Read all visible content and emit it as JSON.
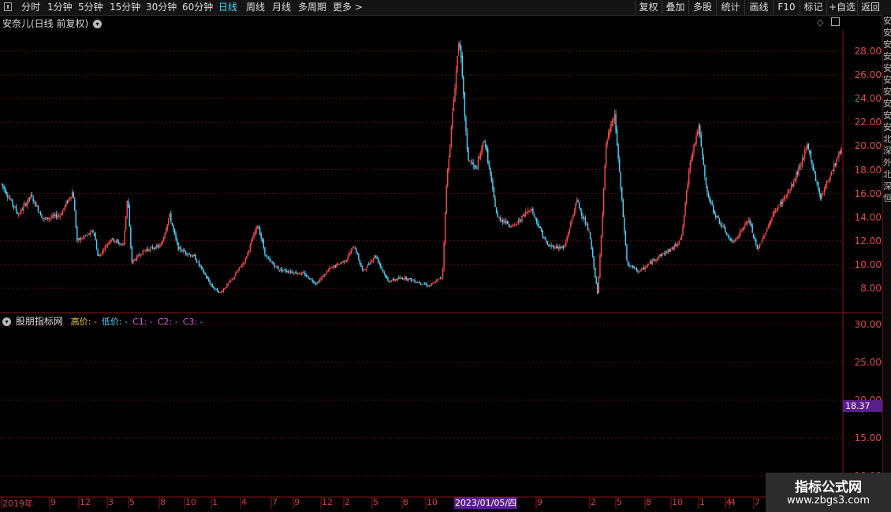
{
  "toolbar": {
    "periods": [
      "分时",
      "1分钟",
      "5分钟",
      "15分钟",
      "30分钟",
      "60分钟",
      "日线",
      "周线",
      "月线",
      "多周期",
      "更多 >"
    ],
    "active_period": "日线",
    "right_buttons": [
      "复权",
      "叠加",
      "多股",
      "统计",
      "画线",
      "F10",
      "标记",
      "+自选",
      "返回"
    ]
  },
  "main_panel": {
    "title": "安奈儿(日线 前复权)",
    "y_ticks": [
      "28.00",
      "26.00",
      "24.00",
      "22.00",
      "20.00",
      "18.00",
      "16.00",
      "14.00",
      "12.00",
      "10.00",
      "8.00"
    ]
  },
  "indicator_panel": {
    "name": "股朋指标网",
    "legend": [
      {
        "text": "高价: -",
        "color": "#e6c84a"
      },
      {
        "text": "低价: -",
        "color": "#4fd7ff"
      },
      {
        "text": "C1: -",
        "color": "#d855d8"
      },
      {
        "text": "C2: -",
        "color": "#d855d8"
      },
      {
        "text": "C3: -",
        "color": "#d855d8"
      }
    ],
    "y_ticks": [
      "30.00",
      "25.00",
      "20.00",
      "15.00",
      "10.00"
    ],
    "current_price": "18.37"
  },
  "x_axis": {
    "labels": [
      "2019年",
      "9",
      "12",
      "3",
      "5",
      "8",
      "10",
      "1",
      "4",
      "7",
      "9",
      "12",
      "2",
      "5",
      "8",
      "10",
      "4",
      "9",
      "2",
      "5",
      "8",
      "10",
      "1",
      "4",
      "7"
    ],
    "crosshair_date": "2023/01/05/四"
  },
  "right_strip_chars": [
    "安",
    "安",
    "安",
    "安",
    "安",
    "安",
    "安",
    "安",
    "安",
    "安",
    "北",
    "深",
    "外",
    "北",
    "深",
    "恒"
  ],
  "watermark": {
    "line1": "指标公式网",
    "line2": "www.zbgs3.com"
  },
  "colors": {
    "up": "#ff4d4d",
    "down": "#4fd7ff",
    "grid": "#5a0d0d",
    "axis": "#8a1818",
    "tag": "#5a1f8a"
  },
  "chart_data": {
    "type": "candlestick",
    "title": "安奈儿(日线 前复权)",
    "ylim": [
      7.0,
      29.8
    ],
    "price_path": [
      [
        0,
        16.8
      ],
      [
        0.02,
        14.2
      ],
      [
        0.035,
        15.8
      ],
      [
        0.05,
        13.8
      ],
      [
        0.07,
        14.2
      ],
      [
        0.085,
        16.2
      ],
      [
        0.09,
        12.0
      ],
      [
        0.11,
        12.8
      ],
      [
        0.115,
        10.6
      ],
      [
        0.13,
        12.2
      ],
      [
        0.145,
        11.6
      ],
      [
        0.15,
        15.8
      ],
      [
        0.155,
        10.2
      ],
      [
        0.17,
        11.2
      ],
      [
        0.19,
        11.6
      ],
      [
        0.2,
        14.2
      ],
      [
        0.21,
        11.4
      ],
      [
        0.23,
        10.6
      ],
      [
        0.25,
        8.2
      ],
      [
        0.26,
        7.6
      ],
      [
        0.275,
        8.8
      ],
      [
        0.29,
        10.4
      ],
      [
        0.305,
        13.4
      ],
      [
        0.315,
        10.6
      ],
      [
        0.33,
        9.6
      ],
      [
        0.36,
        9.2
      ],
      [
        0.375,
        8.4
      ],
      [
        0.39,
        9.6
      ],
      [
        0.41,
        10.4
      ],
      [
        0.42,
        11.6
      ],
      [
        0.43,
        9.4
      ],
      [
        0.445,
        10.8
      ],
      [
        0.46,
        8.6
      ],
      [
        0.48,
        8.9
      ],
      [
        0.51,
        8.2
      ],
      [
        0.525,
        9.0
      ],
      [
        0.53,
        17.0
      ],
      [
        0.535,
        21.0
      ],
      [
        0.545,
        29.4
      ],
      [
        0.555,
        19.0
      ],
      [
        0.565,
        18.0
      ],
      [
        0.575,
        20.6
      ],
      [
        0.59,
        14.0
      ],
      [
        0.61,
        13.2
      ],
      [
        0.63,
        14.8
      ],
      [
        0.65,
        11.6
      ],
      [
        0.67,
        11.4
      ],
      [
        0.685,
        15.4
      ],
      [
        0.7,
        12.6
      ],
      [
        0.71,
        7.4
      ],
      [
        0.72,
        20.2
      ],
      [
        0.73,
        22.6
      ],
      [
        0.745,
        10.0
      ],
      [
        0.76,
        9.4
      ],
      [
        0.78,
        10.6
      ],
      [
        0.8,
        11.4
      ],
      [
        0.81,
        12.4
      ],
      [
        0.82,
        18.8
      ],
      [
        0.83,
        21.6
      ],
      [
        0.84,
        16.0
      ],
      [
        0.85,
        14.2
      ],
      [
        0.87,
        11.8
      ],
      [
        0.89,
        13.8
      ],
      [
        0.9,
        11.2
      ],
      [
        0.92,
        14.4
      ],
      [
        0.94,
        16.4
      ],
      [
        0.96,
        20.0
      ],
      [
        0.975,
        15.6
      ],
      [
        1.0,
        19.8
      ]
    ]
  }
}
